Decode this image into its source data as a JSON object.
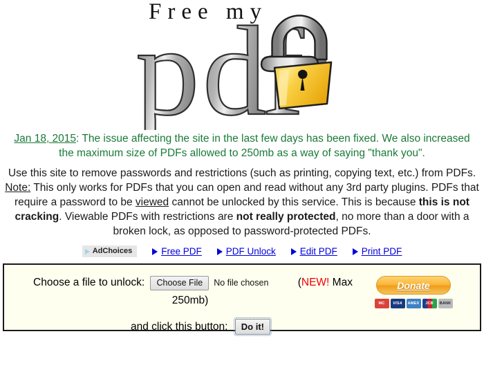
{
  "logo": {
    "tagline": "Free my",
    "wordmark": "pdf",
    "lock_icon": "open-padlock-icon",
    "alt": "Free my PDF"
  },
  "announcement": {
    "date": "Jan 18, 2015",
    "text": ": The issue affecting the site in the last few days has been fixed. We also increased the maximum size of PDFs allowed to 250mb as a way of saying \"thank you\".",
    "color": "#1a7a38"
  },
  "body": {
    "intro": "Use this site to remove passwords and restrictions (such as printing, copying text, etc.) from PDFs.",
    "note_label": "Note:",
    "note_part1": " This only works for PDFs that you can open and read without any 3rd party plugins. PDFs that require a password to be ",
    "note_emph_viewed": "viewed",
    "note_part2": " cannot be unlocked by this service. This is because ",
    "note_bold1": "this is not cracking",
    "note_part3": ". Viewable PDFs with restrictions are ",
    "note_bold2": "not really protected",
    "note_part4": ", no more than a door with a broken lock, as opposed to password-protected PDFs."
  },
  "ads": {
    "adchoices_label": "AdChoices",
    "adchoices_icon": "adchoices-triangle-icon",
    "links": [
      {
        "label": "Free PDF",
        "icon": "play-triangle-icon"
      },
      {
        "label": "PDF Unlock",
        "icon": "play-triangle-icon"
      },
      {
        "label": "Edit PDF",
        "icon": "play-triangle-icon"
      },
      {
        "label": "Print PDF",
        "icon": "play-triangle-icon"
      }
    ]
  },
  "form": {
    "choose_label": "Choose a file to unlock:",
    "file_button_label": "Choose File",
    "file_status": "No file chosen",
    "max_prefix": "(",
    "max_new": "NEW!",
    "max_text": " Max",
    "max_text_line2": "250mb)",
    "max_new_color": "#ee0000",
    "submit_label": "and click this button:",
    "submit_button": "Do it!",
    "background": "#fffff0",
    "border": "#1a1a1a"
  },
  "donate": {
    "button_label": "Donate",
    "cards": [
      {
        "name": "mastercard-icon",
        "label": "MC"
      },
      {
        "name": "visa-icon",
        "label": "VISA"
      },
      {
        "name": "amex-icon",
        "label": "AMEX"
      },
      {
        "name": "jcb-icon",
        "label": "JCB"
      },
      {
        "name": "bank-icon",
        "label": "BANK"
      }
    ]
  }
}
